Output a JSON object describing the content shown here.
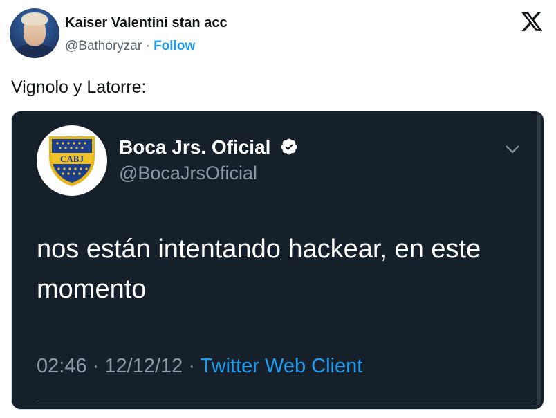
{
  "author": {
    "name": "Kaiser Valentini stan acc",
    "handle": "@Bathoryzar",
    "separator": "·",
    "follow_label": "Follow"
  },
  "brand": {
    "logo_icon": "x-logo-icon"
  },
  "post": {
    "text": "Vignolo y Latorre:"
  },
  "embedded_tweet": {
    "author_name": "Boca Jrs. Oficial",
    "author_handle": "@BocaJrsOficial",
    "verified_icon": "verified-badge-icon",
    "crest_text": "CABJ",
    "menu_icon": "chevron-down-icon",
    "text": "nos están intentando hackear, en este momento",
    "time": "02:46",
    "sep1": "·",
    "date": "12/12/12",
    "sep2": "·",
    "client": "Twitter Web Client",
    "colors": {
      "background": "#15202b",
      "accent": "#1d9bf0",
      "secondary": "#8b98a5"
    }
  }
}
